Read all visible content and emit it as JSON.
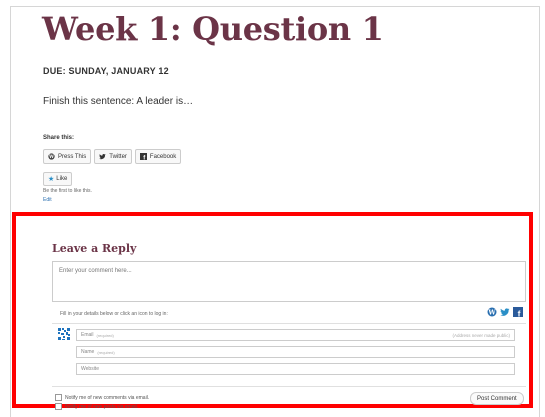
{
  "post": {
    "title": "Week 1: Question 1",
    "due": "DUE: SUNDAY, JANUARY 12",
    "body": "Finish this sentence: A leader is…"
  },
  "share": {
    "heading": "Share this:",
    "buttons": [
      {
        "label": "Press This",
        "icon": "wordpress-icon"
      },
      {
        "label": "Twitter",
        "icon": "twitter-icon"
      },
      {
        "label": "Facebook",
        "icon": "facebook-icon"
      }
    ]
  },
  "like": {
    "button_label": "Like",
    "note": "Be the first to like this.",
    "edit": "Edit"
  },
  "reply": {
    "title": "Leave a Reply",
    "comment_placeholder": "Enter your comment here...",
    "login_hint": "Fill in your details below or click an icon to log in:",
    "fields": {
      "email": {
        "label": "Email",
        "req": "(required)",
        "note": "(Address never made public)"
      },
      "name": {
        "label": "Name",
        "req": "(required)"
      },
      "website": {
        "label": "Website"
      }
    },
    "notify_comments": "Notify me of new comments via email.",
    "notify_posts": "Notify me of new posts via email.",
    "post_button": "Post Comment"
  },
  "colors": {
    "accent": "#6b3447",
    "highlight": "#ff0000",
    "link": "#2a6fb0"
  }
}
